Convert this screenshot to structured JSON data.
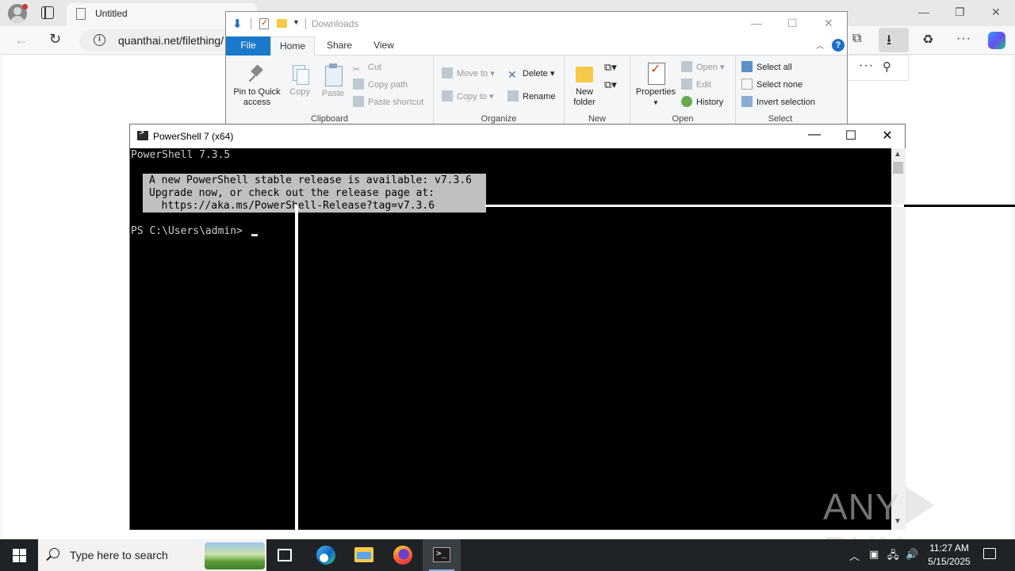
{
  "browser": {
    "tab_title": "Untitled",
    "url": "quanthai.net/filething/",
    "icons": [
      "profile-icon",
      "tab-actions-icon",
      "back-icon",
      "refresh-icon",
      "info-icon",
      "collections-icon",
      "downloads-icon",
      "extensions-icon",
      "more-icon",
      "copilot-icon",
      "pin-icon"
    ]
  },
  "explorer": {
    "title": "Downloads",
    "tabs": [
      "File",
      "Home",
      "Share",
      "View"
    ],
    "clipboard": {
      "pin_label": "Pin to Quick access",
      "copy_label": "Copy",
      "paste_label": "Paste",
      "cut_label": "Cut",
      "copy_path_label": "Copy path",
      "paste_shortcut_label": "Paste shortcut",
      "group_label": "Clipboard"
    },
    "organize": {
      "move_to_label": "Move to",
      "copy_to_label": "Copy to",
      "delete_label": "Delete",
      "rename_label": "Rename",
      "group_label": "Organize"
    },
    "new": {
      "new_folder_label": "New folder",
      "group_label": "New"
    },
    "open": {
      "properties_label": "Properties",
      "open_label": "Open",
      "edit_label": "Edit",
      "history_label": "History",
      "group_label": "Open"
    },
    "select": {
      "select_all_label": "Select all",
      "select_none_label": "Select none",
      "invert_label": "Invert selection",
      "group_label": "Select"
    },
    "help": "?"
  },
  "powershell": {
    "title": "PowerShell 7 (x64)",
    "version_line": "PowerShell 7.3.5",
    "notice_lines": [
      "A new PowerShell stable release is available: v7.3.6",
      "Upgrade now, or check out the release page at:",
      "  https://aka.ms/PowerShell-Release?tag=v7.3.6"
    ],
    "prompt": "PS C:\\Users\\admin> "
  },
  "watermark": {
    "left": "ANY",
    "right": "RUN"
  },
  "taskbar": {
    "search_placeholder": "Type here to search",
    "time": "11:27 AM",
    "date": "5/15/2025",
    "apps": [
      "edge-icon",
      "file-explorer-icon",
      "firefox-icon",
      "powershell-icon"
    ],
    "active_app": "powershell"
  }
}
